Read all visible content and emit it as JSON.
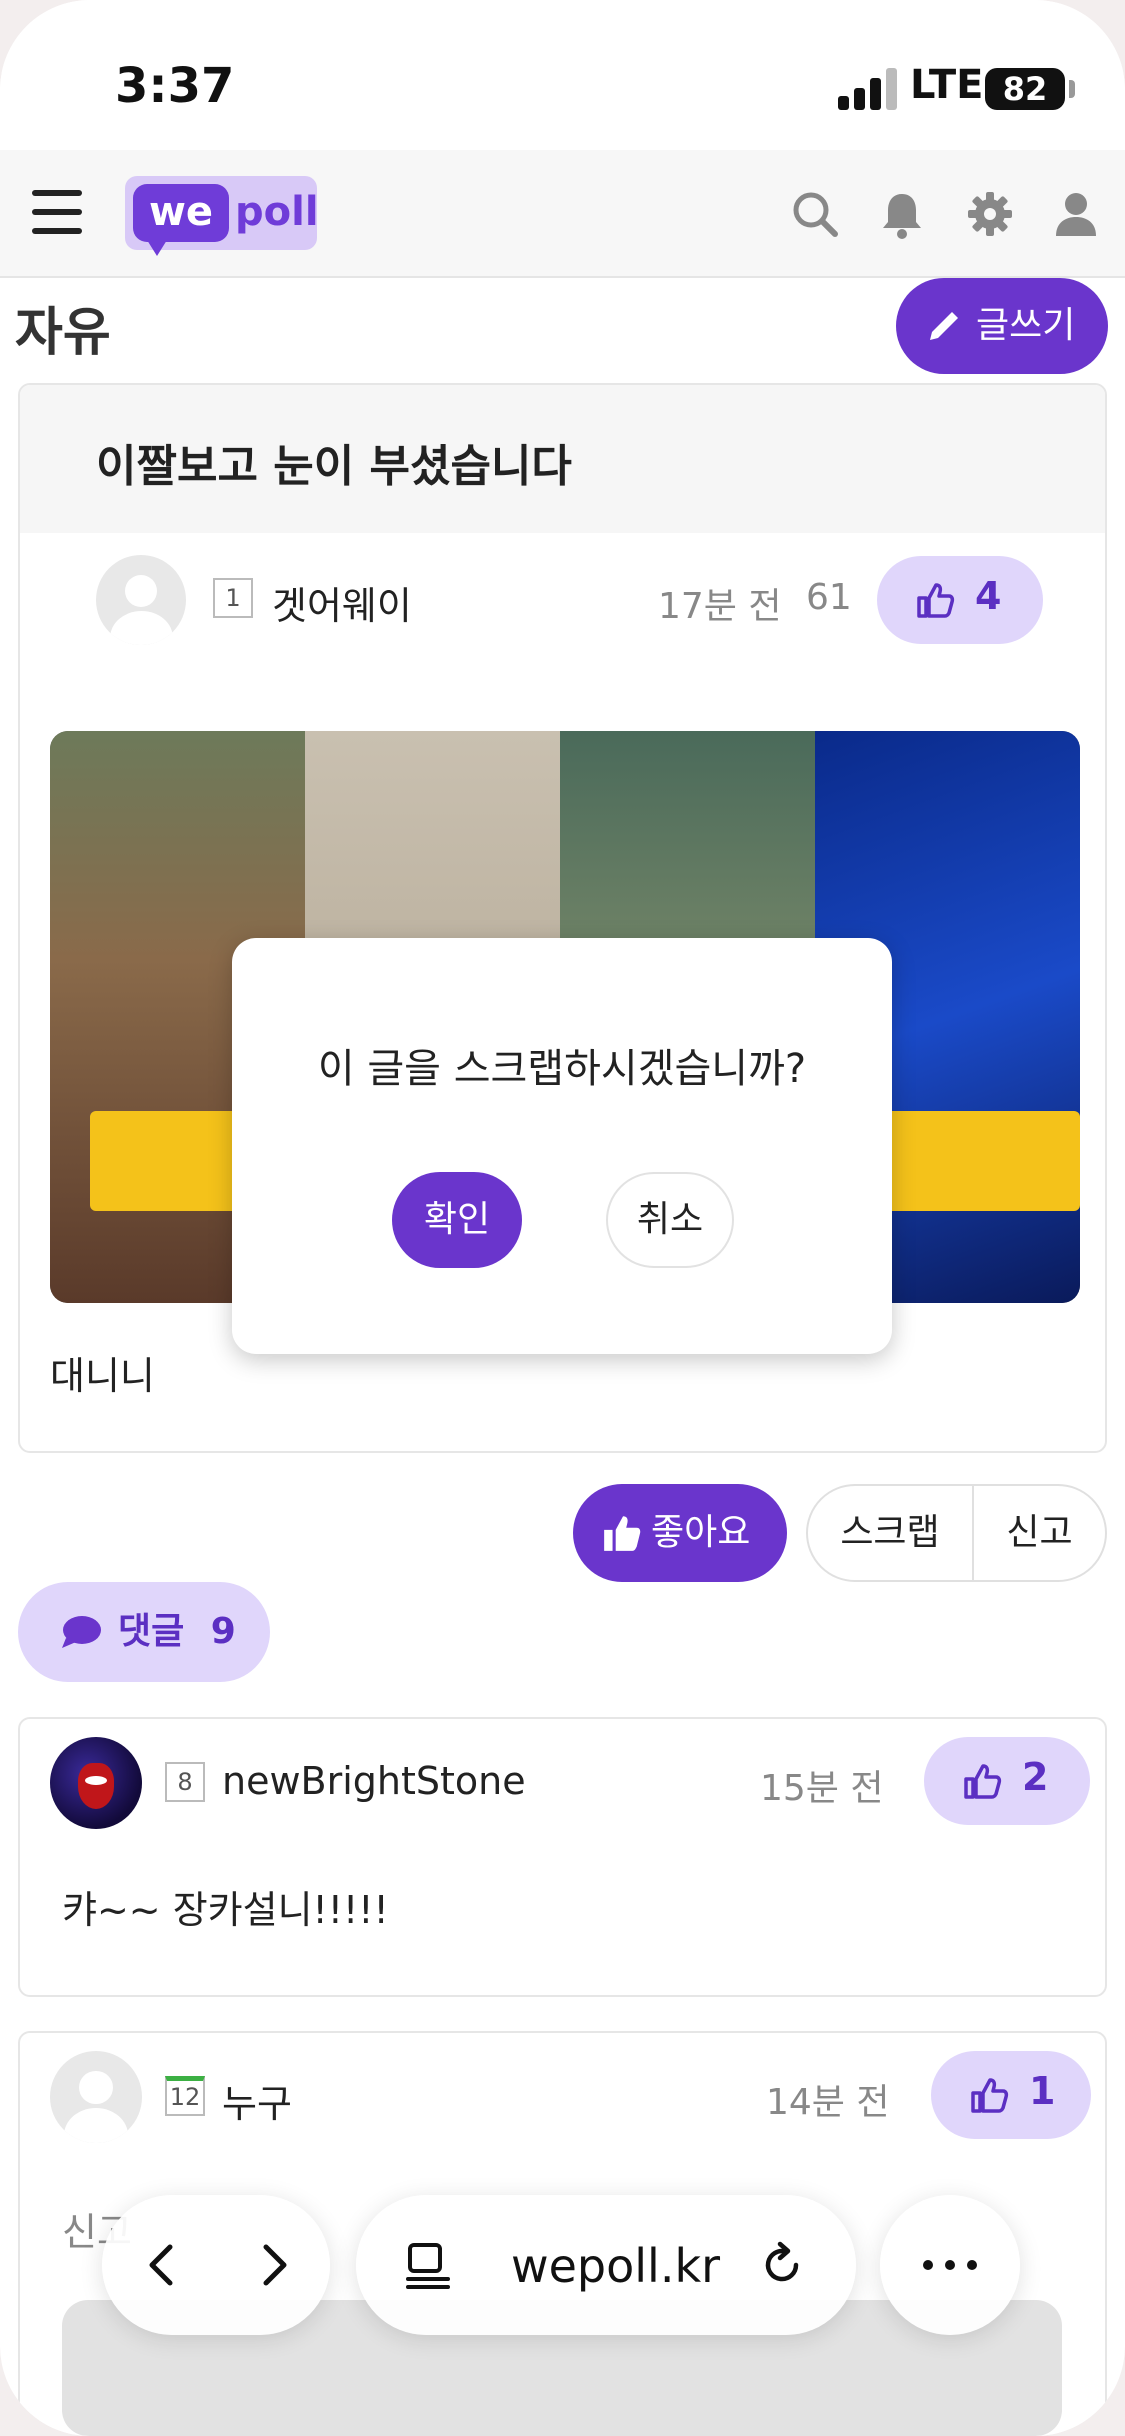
{
  "status_bar": {
    "time": "3:37",
    "network": "LTE",
    "battery": "82"
  },
  "header": {
    "logo_we": "we",
    "logo_poll": "poll",
    "icons": [
      "menu-icon",
      "search-icon",
      "bell-icon",
      "gear-icon",
      "user-icon"
    ]
  },
  "board": {
    "title": "자유",
    "write_label": "글쓰기"
  },
  "post": {
    "title": "이짤보고 눈이 부셨습니다",
    "author": "겟어웨이",
    "author_level": "1",
    "time": "17분 전",
    "views": "61",
    "likes": "4",
    "body": "대니니"
  },
  "actions": {
    "like_label": "좋아요",
    "scrap_label": "스크랩",
    "report_label": "신고"
  },
  "comments_header": {
    "label": "댓글",
    "count": "9"
  },
  "comments": [
    {
      "author": "newBrightStone",
      "level": "8",
      "time": "15분 전",
      "likes": "2",
      "text": "캬~~ 장카설니!!!!!"
    },
    {
      "author": "누구",
      "level": "12",
      "time": "14분 전",
      "likes": "1",
      "text": "신고"
    }
  ],
  "dialog": {
    "message": "이 글을 스크랩하시겠습니까?",
    "confirm": "확인",
    "cancel": "취소"
  },
  "browser": {
    "url": "wepoll.kr"
  },
  "colors": {
    "accent": "#6a35cc",
    "accent_light": "#e0d6fb"
  }
}
